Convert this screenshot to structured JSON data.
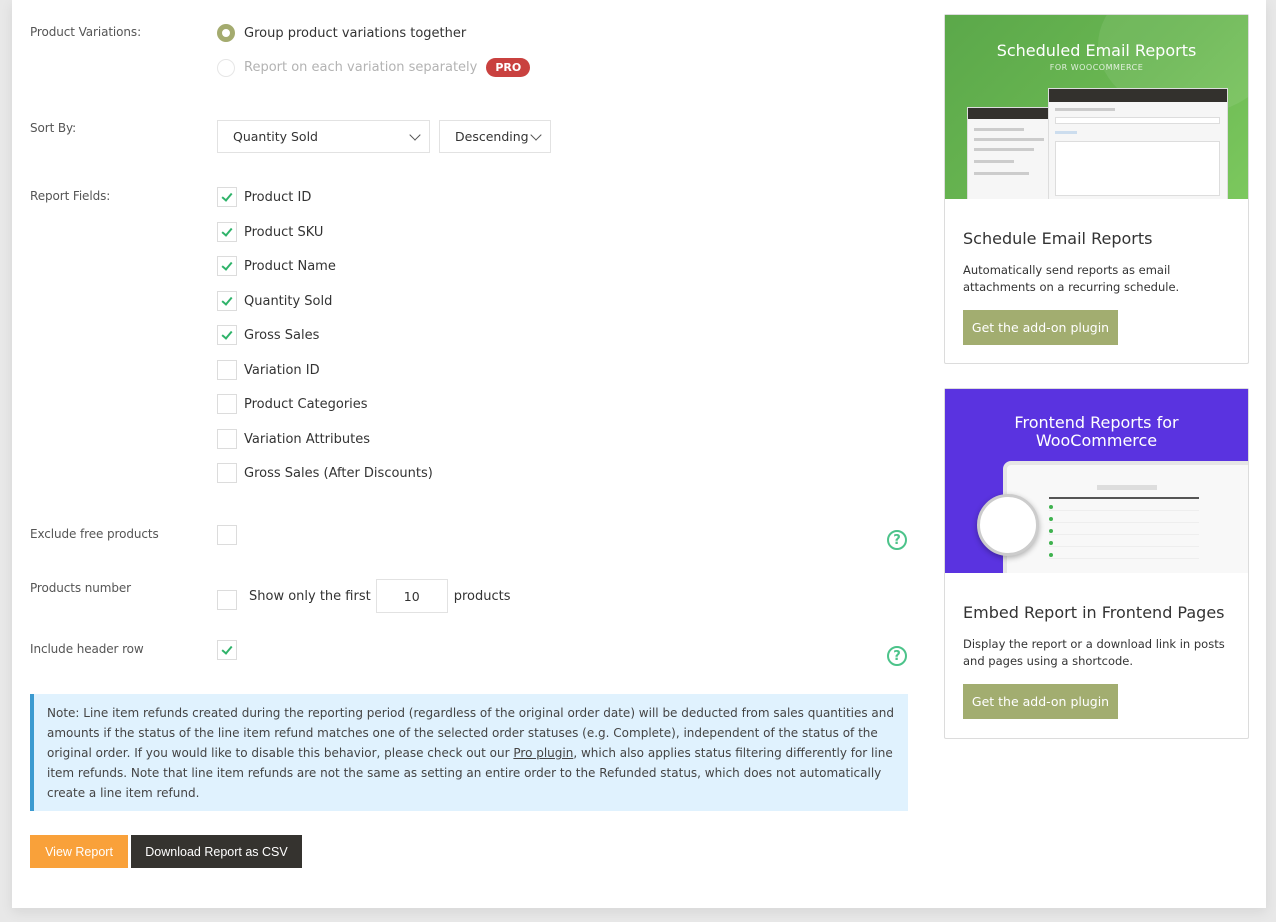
{
  "product_variations": {
    "label": "Product Variations:",
    "options": [
      {
        "label": "Group product variations together",
        "selected": true,
        "disabled": false
      },
      {
        "label": "Report on each variation separately",
        "selected": false,
        "disabled": true,
        "badge": "PRO"
      }
    ]
  },
  "sort_by": {
    "label": "Sort By:",
    "field_value": "Quantity Sold",
    "order_value": "Descending"
  },
  "report_fields": {
    "label": "Report Fields:",
    "items": [
      {
        "label": "Product ID",
        "checked": true
      },
      {
        "label": "Product SKU",
        "checked": true
      },
      {
        "label": "Product Name",
        "checked": true
      },
      {
        "label": "Quantity Sold",
        "checked": true
      },
      {
        "label": "Gross Sales",
        "checked": true
      },
      {
        "label": "Variation ID",
        "checked": false
      },
      {
        "label": "Product Categories",
        "checked": false
      },
      {
        "label": "Variation Attributes",
        "checked": false
      },
      {
        "label": "Gross Sales (After Discounts)",
        "checked": false
      }
    ]
  },
  "exclude_free": {
    "label": "Exclude free products",
    "checked": false
  },
  "products_number": {
    "label": "Products number",
    "checked": false,
    "prefix": "Show only the first",
    "value": "10",
    "suffix": "products"
  },
  "header_row": {
    "label": "Include header row",
    "checked": true
  },
  "help_icon": "?",
  "note": {
    "text_before": "Note: Line item refunds created during the reporting period (regardless of the original order date) will be deducted from sales quantities and amounts if the status of the line item refund matches one of the selected order statuses (e.g. Complete), independent of the status of the original order. If you would like to disable this behavior, please check out our ",
    "link": "Pro plugin",
    "text_after": ", which also applies status filtering differently for line item refunds. Note that line item refunds are not the same as setting an entire order to the Refunded status, which does not automatically create a line item refund."
  },
  "buttons": {
    "view_report": "View Report",
    "download_csv": "Download Report as CSV"
  },
  "sidebar": {
    "cards": [
      {
        "image_title": "Scheduled Email Reports",
        "image_subtitle": "FOR WOOCOMMERCE",
        "title": "Schedule Email Reports",
        "description": "Automatically send reports as email attachments on a recurring schedule.",
        "button": "Get the add-on plugin"
      },
      {
        "image_title": "Frontend Reports for WooCommerce",
        "title": "Embed Report in Frontend Pages",
        "description": "Display the report or a download link in posts and pages using a shortcode.",
        "button": "Get the add-on plugin"
      }
    ]
  },
  "colors": {
    "accent_olive": "#a2ad70",
    "pro_red": "#c9413f",
    "check_green": "#2fb36a",
    "view_orange": "#f9a13a",
    "download_dark": "#35332f",
    "note_bg": "#e0f2fe",
    "note_border": "#3b9ad0"
  }
}
